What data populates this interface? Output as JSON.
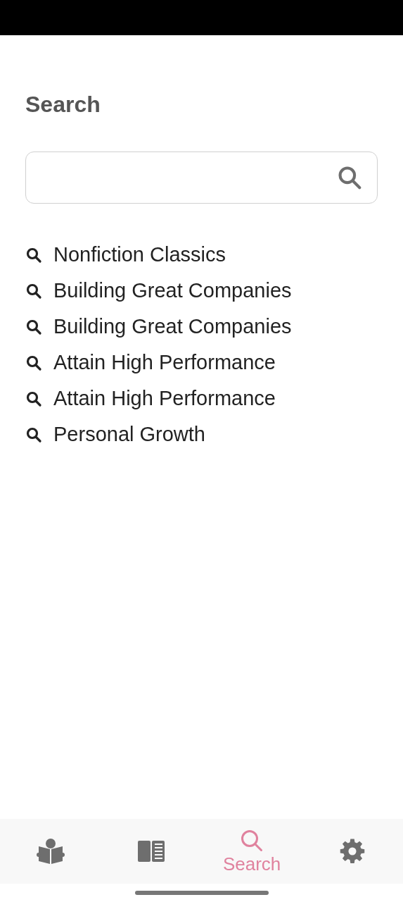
{
  "header": {
    "title": "Search"
  },
  "history": [
    {
      "text": "Nonfiction Classics"
    },
    {
      "text": "Building Great Companies"
    },
    {
      "text": "Building Great Companies"
    },
    {
      "text": "Attain High Performance"
    },
    {
      "text": "Attain High Performance"
    },
    {
      "text": "Personal Growth"
    }
  ],
  "tabs": [
    {
      "kind": "reader",
      "selected": false
    },
    {
      "kind": "book",
      "selected": false
    },
    {
      "kind": "search",
      "label": "Search",
      "selected": true
    },
    {
      "kind": "settings",
      "selected": false
    }
  ]
}
